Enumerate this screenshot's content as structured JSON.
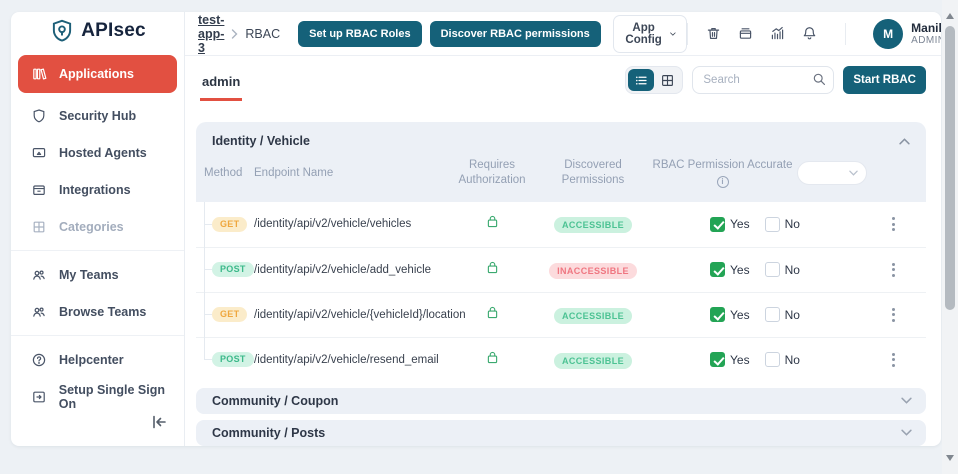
{
  "sidebar": {
    "logo_text": "APIsec",
    "items": [
      {
        "label": "Applications",
        "icon": "library-icon",
        "active": true
      },
      {
        "label": "Security Hub",
        "icon": "shield-icon"
      },
      {
        "label": "Hosted Agents",
        "icon": "monitor-icon"
      },
      {
        "label": "Integrations",
        "icon": "box-icon"
      },
      {
        "label": "Categories",
        "icon": "grid-icon",
        "muted": true,
        "divider_after": true
      },
      {
        "label": "My Teams",
        "icon": "team-icon"
      },
      {
        "label": "Browse Teams",
        "icon": "team-icon",
        "divider_after": true
      },
      {
        "label": "Helpcenter",
        "icon": "help-icon"
      },
      {
        "label": "Setup Single Sign On",
        "icon": "sign-on-icon"
      }
    ]
  },
  "header": {
    "breadcrumb": {
      "app": "test-app-3",
      "separator": "›",
      "page": "RBAC"
    },
    "actions": [
      {
        "label": "Set up RBAC Roles"
      },
      {
        "label": "Discover RBAC permissions"
      }
    ],
    "app_config_label": "App Config",
    "icons": [
      "trash-icon",
      "archive-icon",
      "analytics-icon",
      "notifications-icon"
    ],
    "user": {
      "initial": "M",
      "name": "Manikanta",
      "role": "ADMIN"
    }
  },
  "content": {
    "tab_label": "admin",
    "search_placeholder": "Search",
    "start_rbac_label": "Start RBAC",
    "table": {
      "section_title": "Identity / Vehicle",
      "columns": {
        "method": "Method",
        "endpoint": "Endpoint Name",
        "auth": "Requires Authorization",
        "discovered": "Discovered Permissions",
        "accurate": "RBAC Permission Accurate"
      },
      "yes_label": "Yes",
      "no_label": "No",
      "rows": [
        {
          "method": "GET",
          "endpoint": "/identity/api/v2/vehicle/vehicles",
          "requires_auth": true,
          "discovered": "ACCESSIBLE",
          "accurate": "yes"
        },
        {
          "method": "POST",
          "endpoint": "/identity/api/v2/vehicle/add_vehicle",
          "requires_auth": true,
          "discovered": "INACCESSIBLE",
          "accurate": "yes"
        },
        {
          "method": "GET",
          "endpoint": "/identity/api/v2/vehicle/{vehicleId}/location",
          "requires_auth": true,
          "discovered": "ACCESSIBLE",
          "accurate": "yes"
        },
        {
          "method": "POST",
          "endpoint": "/identity/api/v2/vehicle/resend_email",
          "requires_auth": true,
          "discovered": "ACCESSIBLE",
          "accurate": "yes"
        }
      ]
    },
    "collapsed_sections": [
      {
        "title": "Community / Coupon"
      },
      {
        "title": "Community / Posts"
      }
    ]
  },
  "colors": {
    "primary_teal": "#156179",
    "accent_red": "#e25041",
    "checkbox_green": "#23a455",
    "get_badge_text": "#efa73e",
    "post_badge_text": "#3cb98a",
    "accessible_text": "#4cc293",
    "inaccessible_text": "#ef7681",
    "lock_green": "#3aa96f",
    "section_header_bg": "#ecf0f6",
    "page_bg": "#edf1f5"
  }
}
